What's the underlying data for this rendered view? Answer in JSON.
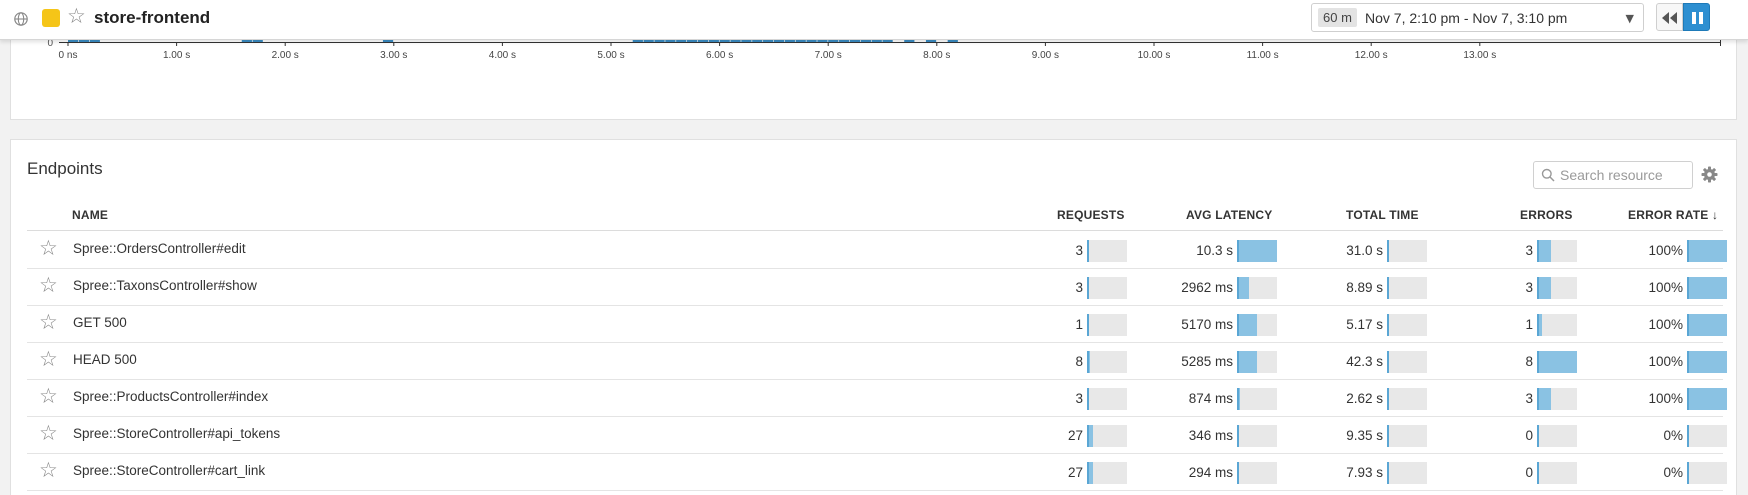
{
  "header": {
    "service_name": "store-frontend",
    "service_color": "#f5c518",
    "icons": {
      "globe": "globe-icon",
      "favorite": "star-outline-icon",
      "rewind": "rewind-icon",
      "pause": "pause-icon"
    },
    "time_picker": {
      "duration": "60 m",
      "range": "Nov 7, 2:10 pm - Nov 7, 3:10 pm"
    }
  },
  "latency_chart": {
    "y_tick": "0",
    "bar_color": "#3a8dc4",
    "xticks": [
      "0 ns",
      "1.00 s",
      "2.00 s",
      "3.00 s",
      "4.00 s",
      "5.00 s",
      "6.00 s",
      "7.00 s",
      "8.00 s",
      "9.00 s",
      "10.00 s",
      "11.00 s",
      "12.00 s",
      "13.00 s"
    ]
  },
  "chart_data": {
    "type": "bar",
    "x_unit": "s",
    "xlim": [
      0,
      13.5
    ],
    "bins": [
      {
        "x": 0.0,
        "v": 4
      },
      {
        "x": 0.1,
        "v": 4
      },
      {
        "x": 0.2,
        "v": 4
      },
      {
        "x": 1.6,
        "v": 1
      },
      {
        "x": 1.7,
        "v": 1
      },
      {
        "x": 2.9,
        "v": 1
      },
      {
        "x": 5.2,
        "v": 1
      },
      {
        "x": 5.3,
        "v": 1
      },
      {
        "x": 5.4,
        "v": 1
      },
      {
        "x": 5.5,
        "v": 1
      },
      {
        "x": 5.6,
        "v": 2
      },
      {
        "x": 5.7,
        "v": 1
      },
      {
        "x": 5.8,
        "v": 1
      },
      {
        "x": 5.9,
        "v": 1
      },
      {
        "x": 6.0,
        "v": 2
      },
      {
        "x": 6.1,
        "v": 2
      },
      {
        "x": 6.2,
        "v": 2
      },
      {
        "x": 6.3,
        "v": 3
      },
      {
        "x": 6.4,
        "v": 2
      },
      {
        "x": 6.5,
        "v": 2
      },
      {
        "x": 6.6,
        "v": 1
      },
      {
        "x": 6.7,
        "v": 3
      },
      {
        "x": 6.8,
        "v": 2
      },
      {
        "x": 6.9,
        "v": 1
      },
      {
        "x": 7.0,
        "v": 1
      },
      {
        "x": 7.1,
        "v": 1
      },
      {
        "x": 7.2,
        "v": 1
      },
      {
        "x": 7.3,
        "v": 1
      },
      {
        "x": 7.4,
        "v": 1
      },
      {
        "x": 7.5,
        "v": 1
      },
      {
        "x": 7.7,
        "v": 1
      },
      {
        "x": 7.9,
        "v": 1
      },
      {
        "x": 8.1,
        "v": 1
      }
    ]
  },
  "endpoints": {
    "title": "Endpoints",
    "search_placeholder": "Search resource",
    "columns": {
      "name": "NAME",
      "requests": "REQUESTS",
      "avg_latency": "AVG LATENCY",
      "total_time": "TOTAL TIME",
      "errors": "ERRORS",
      "error_rate": "ERROR RATE",
      "sort_indicator": "↓"
    },
    "rows": [
      {
        "name": "Spree::OrdersController#edit",
        "requests": "3",
        "requests_frac": 0.03,
        "avg_latency": "10.3 s",
        "latency_frac": 1.0,
        "total_time": "31.0 s",
        "total_frac": 0.02,
        "errors": "3",
        "errors_frac": 0.35,
        "error_rate": "100%",
        "rate_frac": 1.0
      },
      {
        "name": "Spree::TaxonsController#show",
        "requests": "3",
        "requests_frac": 0.03,
        "avg_latency": "2962 ms",
        "latency_frac": 0.29,
        "total_time": "8.89 s",
        "total_frac": 0.01,
        "errors": "3",
        "errors_frac": 0.35,
        "error_rate": "100%",
        "rate_frac": 1.0
      },
      {
        "name": "GET 500",
        "requests": "1",
        "requests_frac": 0.01,
        "avg_latency": "5170 ms",
        "latency_frac": 0.5,
        "total_time": "5.17 s",
        "total_frac": 0.01,
        "errors": "1",
        "errors_frac": 0.12,
        "error_rate": "100%",
        "rate_frac": 1.0
      },
      {
        "name": "HEAD 500",
        "requests": "8",
        "requests_frac": 0.07,
        "avg_latency": "5285 ms",
        "latency_frac": 0.51,
        "total_time": "42.3 s",
        "total_frac": 0.03,
        "errors": "8",
        "errors_frac": 1.0,
        "error_rate": "100%",
        "rate_frac": 1.0
      },
      {
        "name": "Spree::ProductsController#index",
        "requests": "3",
        "requests_frac": 0.03,
        "avg_latency": "874 ms",
        "latency_frac": 0.08,
        "total_time": "2.62 s",
        "total_frac": 0.01,
        "errors": "3",
        "errors_frac": 0.35,
        "error_rate": "100%",
        "rate_frac": 1.0
      },
      {
        "name": "Spree::StoreController#api_tokens",
        "requests": "27",
        "requests_frac": 0.15,
        "avg_latency": "346 ms",
        "latency_frac": 0.03,
        "total_time": "9.35 s",
        "total_frac": 0.01,
        "errors": "0",
        "errors_frac": 0.0,
        "error_rate": "0%",
        "rate_frac": 0.0
      },
      {
        "name": "Spree::StoreController#cart_link",
        "requests": "27",
        "requests_frac": 0.15,
        "avg_latency": "294 ms",
        "latency_frac": 0.03,
        "total_time": "7.93 s",
        "total_frac": 0.01,
        "errors": "0",
        "errors_frac": 0.0,
        "error_rate": "0%",
        "rate_frac": 0.0
      }
    ]
  }
}
